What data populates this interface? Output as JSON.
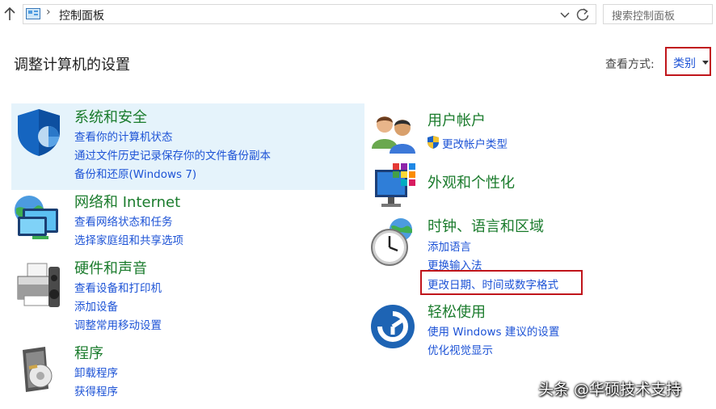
{
  "address_bar": {
    "path": "控制面板",
    "search_placeholder": "搜索控制面板"
  },
  "header": {
    "title": "调整计算机的设置",
    "view_by_label": "查看方式:",
    "view_by_value": "类别"
  },
  "categories": {
    "system_security": {
      "title": "系统和安全",
      "links": [
        "查看你的计算机状态",
        "通过文件历史记录保存你的文件备份副本",
        "备份和还原(Windows 7)"
      ]
    },
    "network": {
      "title": "网络和 Internet",
      "links": [
        "查看网络状态和任务",
        "选择家庭组和共享选项"
      ]
    },
    "hardware": {
      "title": "硬件和声音",
      "links": [
        "查看设备和打印机",
        "添加设备",
        "调整常用移动设置"
      ]
    },
    "programs": {
      "title": "程序",
      "links": [
        "卸载程序",
        "获得程序"
      ]
    },
    "user_accounts": {
      "title": "用户帐户",
      "links": [
        "更改帐户类型"
      ]
    },
    "appearance": {
      "title": "外观和个性化",
      "links": []
    },
    "clock_region": {
      "title": "时钟、语言和区域",
      "links": [
        "添加语言",
        "更换输入法",
        "更改日期、时间或数字格式"
      ]
    },
    "ease_of_access": {
      "title": "轻松使用",
      "links": [
        "使用 Windows 建议的设置",
        "优化视觉显示"
      ]
    }
  },
  "watermark": "头条 @华硕技术支持",
  "colors": {
    "category_title": "#1a7b2c",
    "link": "#1d53d6",
    "highlight_bg": "#e5f3fb",
    "annotation_border": "#c0151b"
  },
  "icons": {
    "up": "up-arrow-icon",
    "refresh": "refresh-icon",
    "dropdown": "chevron-down-icon",
    "uac": "uac-shield-icon"
  }
}
